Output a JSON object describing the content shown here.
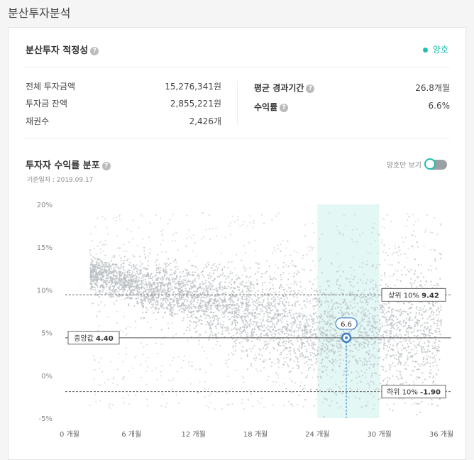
{
  "page": {
    "title": "분산투자분석"
  },
  "adequacy": {
    "title": "분산투자 적정성",
    "status": "양호",
    "status_color": "#1fbfae"
  },
  "stats_left": [
    {
      "label": "전체 투자금액",
      "value": "15,276,341원"
    },
    {
      "label": "투자금 잔액",
      "value": "2,855,221원"
    },
    {
      "label": "채권수",
      "value": "2,426개"
    }
  ],
  "stats_right": [
    {
      "label": "평균 경과기간",
      "value": "26.8개월"
    },
    {
      "label": "수익률",
      "value": "6.6%"
    }
  ],
  "distribution": {
    "title": "투자자 수익률 분포",
    "reference_date": "기준일자 : 2019.09.17",
    "toggle_label": "양호만 보기",
    "toggle_on": false
  },
  "chart_data": {
    "type": "scatter",
    "x_ticks": [
      "0 개월",
      "6 개월",
      "12 개월",
      "18 개월",
      "24 개월",
      "30 개월",
      "36 개월"
    ],
    "y_ticks": [
      "20%",
      "15%",
      "10%",
      "5%",
      "0%",
      "-5%"
    ],
    "xlim": [
      0,
      36
    ],
    "ylim": [
      -5,
      20
    ],
    "highlight_band_x": [
      24,
      30
    ],
    "reference_lines": [
      {
        "label": "상위 10%",
        "value": "9.42",
        "y": 9.42,
        "style": "dashed"
      },
      {
        "label": "중앙값",
        "value": "4.40",
        "y": 4.4,
        "style": "solid"
      },
      {
        "label": "하위 10%",
        "value": "-1.90",
        "y": -1.9,
        "style": "dashed"
      }
    ],
    "user_point": {
      "x": 26.8,
      "y": 4.4,
      "label": "6.6"
    },
    "point_color": "#b8bdc2",
    "band_color": "#e3f7f5",
    "marker_color": "#3d7fc1"
  }
}
